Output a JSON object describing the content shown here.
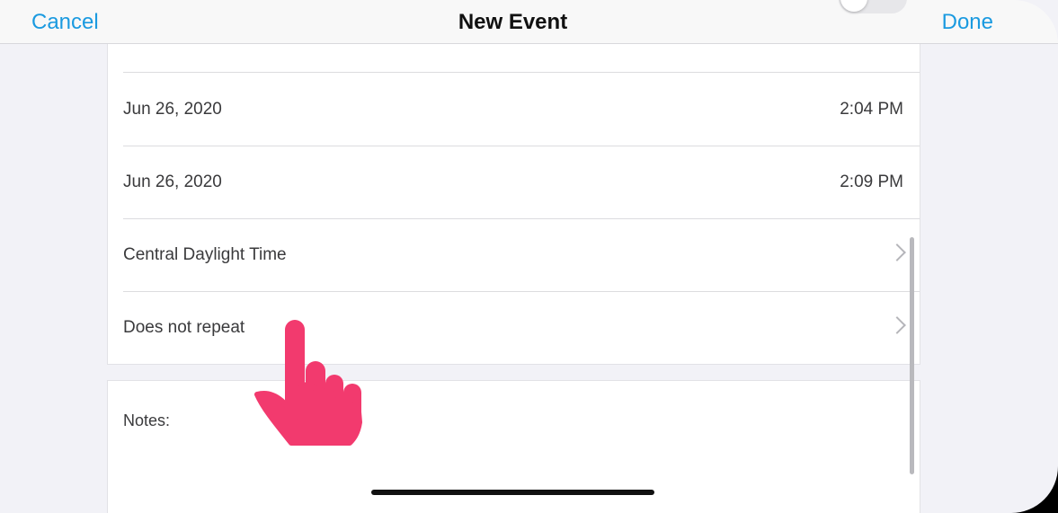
{
  "navbar": {
    "cancel_label": "Cancel",
    "title": "New Event",
    "done_label": "Done"
  },
  "rows": {
    "start": {
      "date": "Jun 26, 2020",
      "time": "2:04 PM"
    },
    "end": {
      "date": "Jun 26, 2020",
      "time": "2:09 PM"
    },
    "timezone": {
      "label": "Central Daylight Time"
    },
    "repeat": {
      "label": "Does not repeat"
    }
  },
  "notes": {
    "label": "Notes:"
  },
  "toggle": {
    "on": false
  },
  "colors": {
    "accent": "#1a9ae0",
    "pointer": "#f23a6e"
  },
  "icons": {
    "chevron": "chevron-right-icon",
    "pointer": "hand-pointer-icon"
  }
}
